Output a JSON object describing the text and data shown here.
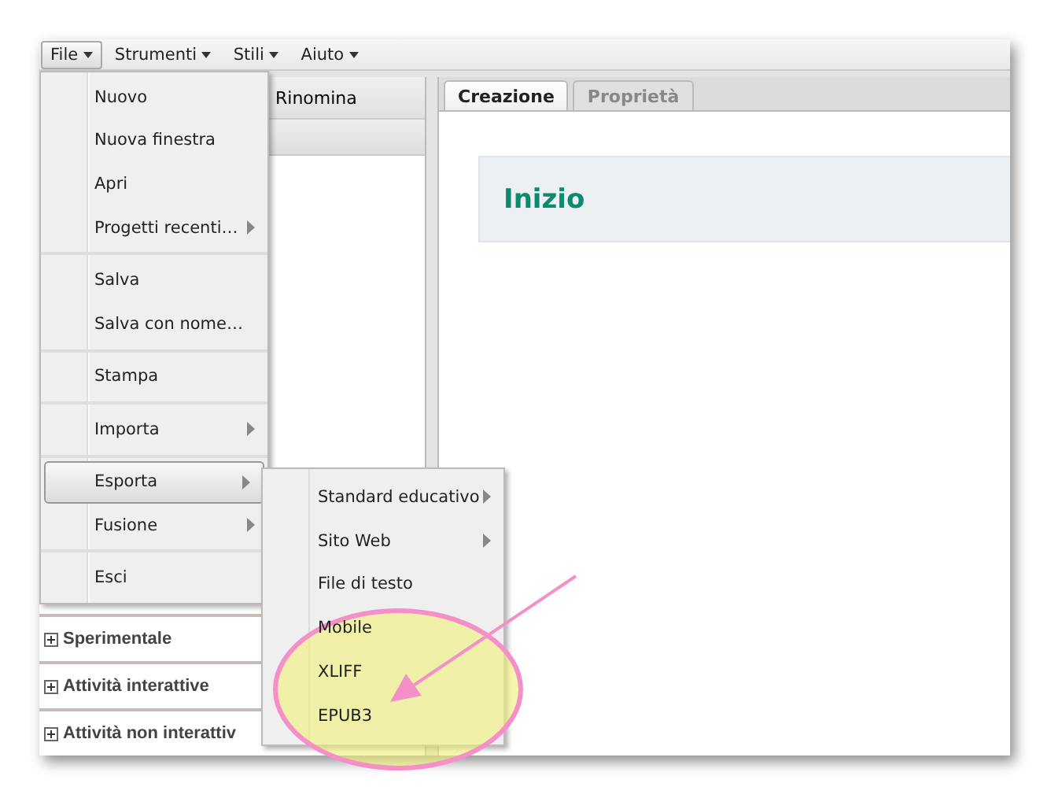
{
  "menubar": [
    {
      "label": "File",
      "selected": true
    },
    {
      "label": "Strumenti",
      "selected": false
    },
    {
      "label": "Stili",
      "selected": false
    },
    {
      "label": "Aiuto",
      "selected": false
    }
  ],
  "left_panel": {
    "rename_button": "Rinomina",
    "tree_items": [
      {
        "label": "Sperimentale",
        "expanded": false
      },
      {
        "label": "Attività interattive",
        "expanded": false
      },
      {
        "label": "Attività non interattiv",
        "expanded": false
      }
    ]
  },
  "tabs": [
    {
      "label": "Creazione",
      "selected": true
    },
    {
      "label": "Proprietà",
      "selected": false
    }
  ],
  "content": {
    "heading": "Inizio"
  },
  "file_menu": [
    [
      {
        "label": "Nuovo",
        "submenu": false,
        "selected": false
      },
      {
        "label": "Nuova finestra",
        "submenu": false,
        "selected": false
      },
      {
        "label": "Apri",
        "submenu": false,
        "selected": false
      },
      {
        "label": "Progetti recenti…",
        "submenu": true,
        "selected": false
      }
    ],
    [
      {
        "label": "Salva",
        "submenu": false,
        "selected": false
      },
      {
        "label": "Salva con nome…",
        "submenu": false,
        "selected": false
      }
    ],
    [
      {
        "label": "Stampa",
        "submenu": false,
        "selected": false
      }
    ],
    [
      {
        "label": "Importa",
        "submenu": true,
        "selected": false
      }
    ],
    [
      {
        "label": "Esporta",
        "submenu": true,
        "selected": true
      },
      {
        "label": "Fusione",
        "submenu": true,
        "selected": false
      }
    ],
    [
      {
        "label": "Esci",
        "submenu": false,
        "selected": false
      }
    ]
  ],
  "export_submenu": [
    {
      "label": "Standard educativo",
      "submenu": true
    },
    {
      "label": "Sito Web",
      "submenu": true
    },
    {
      "label": "File di testo",
      "submenu": false
    },
    {
      "label": "Mobile",
      "submenu": false
    },
    {
      "label": "XLIFF",
      "submenu": false
    },
    {
      "label": "EPUB3",
      "submenu": false
    }
  ]
}
